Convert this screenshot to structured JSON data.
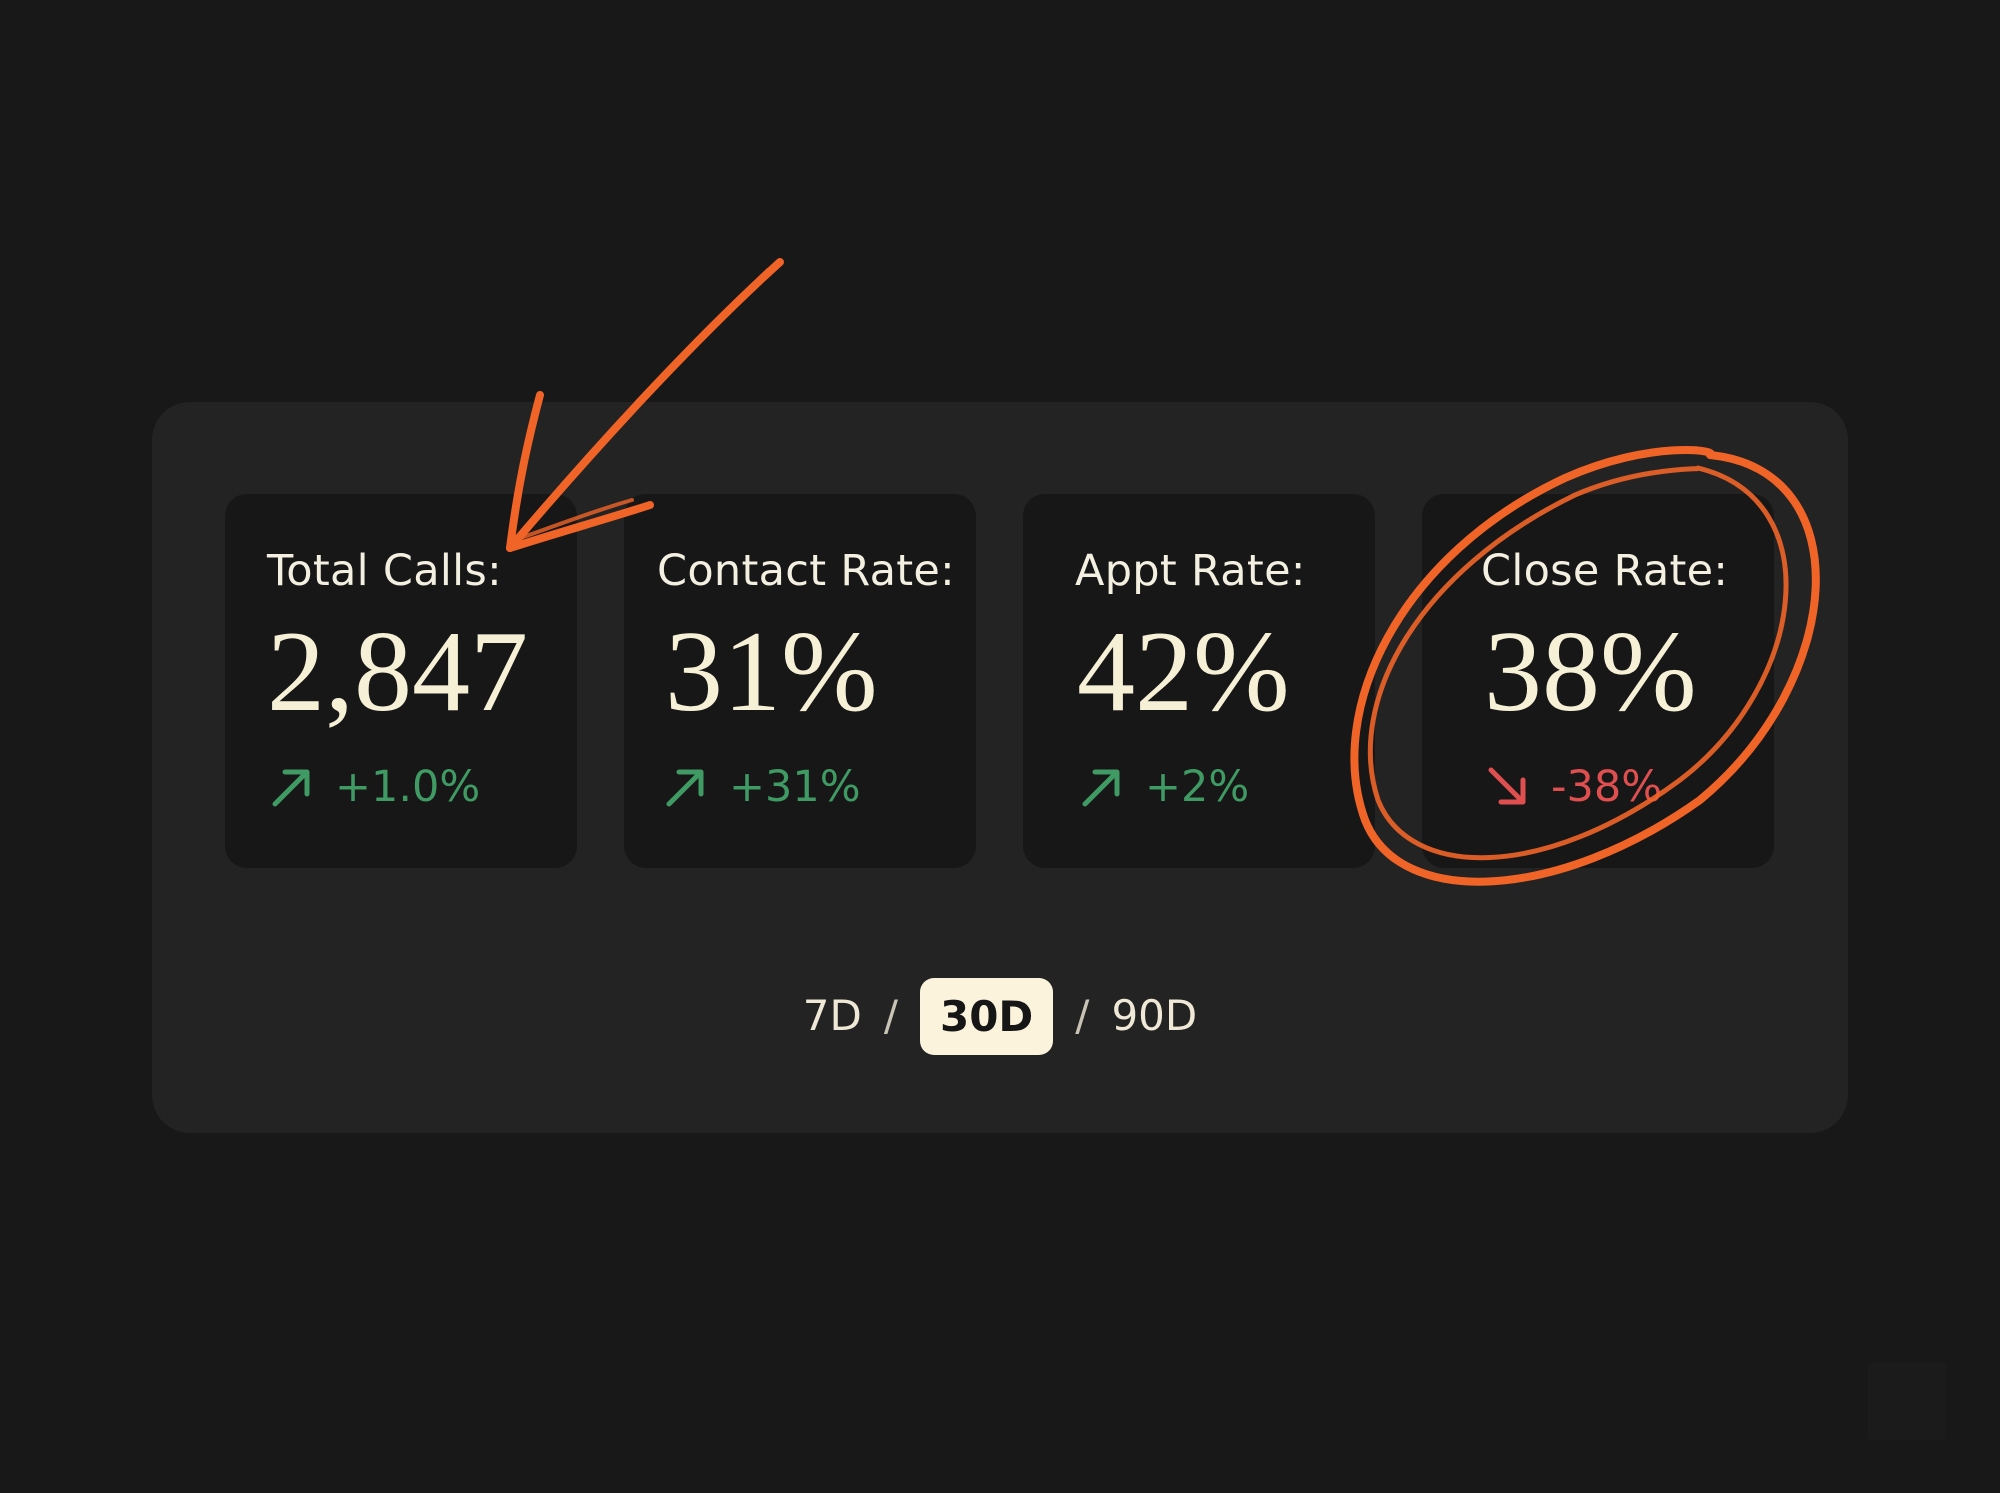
{
  "metrics": [
    {
      "label": "Total Calls:",
      "value": "2,847",
      "delta": "+1.0%",
      "trend": "up",
      "icon": "trend-up-arrow-icon"
    },
    {
      "label": "Contact Rate:",
      "value": "31%",
      "delta": "+31%",
      "trend": "up",
      "icon": "trend-up-arrow-icon"
    },
    {
      "label": "Appt Rate:",
      "value": "42%",
      "delta": "+2%",
      "trend": "up",
      "icon": "trend-up-arrow-icon"
    },
    {
      "label": "Close Rate:",
      "value": "38%",
      "delta": "-38%",
      "trend": "down",
      "icon": "trend-down-arrow-icon"
    }
  ],
  "range": {
    "options": [
      "7D",
      "30D",
      "90D"
    ],
    "selected": "30D",
    "separator": "/"
  },
  "colors": {
    "background": "#181818",
    "panel": "#232323",
    "card": "#171717",
    "text": "#f3efe1",
    "positive": "#3f9a63",
    "negative": "#df4f4f",
    "selected_chip": "#fbf3dc",
    "annotation": "#f06428"
  },
  "annotations": [
    {
      "type": "hand-drawn-arrow",
      "target": "Total Calls"
    },
    {
      "type": "hand-drawn-circle",
      "target": "Close Rate"
    }
  ]
}
